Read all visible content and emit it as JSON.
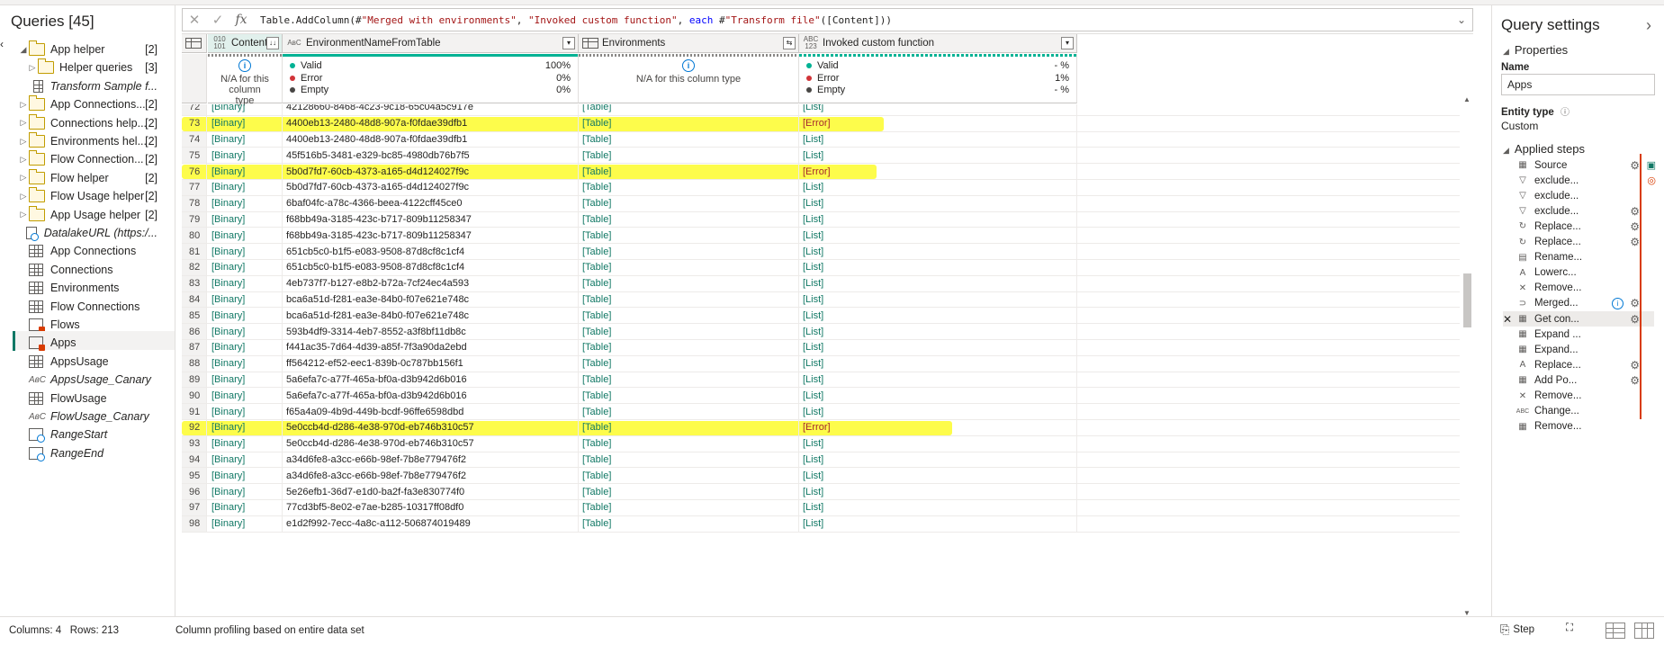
{
  "queries": {
    "title": "Queries [45]",
    "items": [
      {
        "label": "App helper",
        "count": "[2]",
        "type": "folder",
        "expand": "◢",
        "indent": 0
      },
      {
        "label": "Helper queries",
        "count": "[3]",
        "type": "folder",
        "expand": "▷",
        "indent": 1
      },
      {
        "label": "Transform Sample f...",
        "count": "",
        "type": "table",
        "expand": "",
        "indent": 1,
        "italic": true
      },
      {
        "label": "App Connections...",
        "count": "[2]",
        "type": "folder",
        "expand": "▷",
        "indent": 0
      },
      {
        "label": "Connections help...",
        "count": "[2]",
        "type": "folder",
        "expand": "▷",
        "indent": 0
      },
      {
        "label": "Environments hel...",
        "count": "[2]",
        "type": "folder",
        "expand": "▷",
        "indent": 0
      },
      {
        "label": "Flow Connection...",
        "count": "[2]",
        "type": "folder",
        "expand": "▷",
        "indent": 0
      },
      {
        "label": "Flow helper",
        "count": "[2]",
        "type": "folder",
        "expand": "▷",
        "indent": 0
      },
      {
        "label": "Flow Usage helper",
        "count": "[2]",
        "type": "folder",
        "expand": "▷",
        "indent": 0
      },
      {
        "label": "App Usage helper",
        "count": "[2]",
        "type": "folder",
        "expand": "▷",
        "indent": 0
      },
      {
        "label": "DatalakeURL (https:/...",
        "count": "",
        "type": "param",
        "expand": "",
        "indent": 0,
        "italic": true
      },
      {
        "label": "App Connections",
        "count": "",
        "type": "table",
        "expand": "",
        "indent": 0
      },
      {
        "label": "Connections",
        "count": "",
        "type": "table",
        "expand": "",
        "indent": 0
      },
      {
        "label": "Environments",
        "count": "",
        "type": "table",
        "expand": "",
        "indent": 0
      },
      {
        "label": "Flow Connections",
        "count": "",
        "type": "table",
        "expand": "",
        "indent": 0
      },
      {
        "label": "Flows",
        "count": "",
        "type": "tablewarn",
        "expand": "",
        "indent": 0
      },
      {
        "label": "Apps",
        "count": "",
        "type": "tablewarn",
        "expand": "",
        "indent": 0,
        "selected": true
      },
      {
        "label": "AppsUsage",
        "count": "",
        "type": "table",
        "expand": "",
        "indent": 0
      },
      {
        "label": "AppsUsage_Canary",
        "count": "",
        "type": "abc",
        "expand": "",
        "indent": 0,
        "italic": true
      },
      {
        "label": "FlowUsage",
        "count": "",
        "type": "table",
        "expand": "",
        "indent": 0
      },
      {
        "label": "FlowUsage_Canary",
        "count": "",
        "type": "abc",
        "expand": "",
        "indent": 0,
        "italic": true
      },
      {
        "label": "RangeStart",
        "count": "",
        "type": "param",
        "expand": "",
        "indent": 0,
        "italic": true
      },
      {
        "label": "RangeEnd",
        "count": "",
        "type": "param",
        "expand": "",
        "indent": 0,
        "italic": true
      }
    ]
  },
  "formula": {
    "cancel": "✕",
    "commit": "✓",
    "fx": "fx",
    "parts": [
      {
        "t": "Table.AddColumn(#",
        "c": ""
      },
      {
        "t": "\"Merged with environments\"",
        "c": "s"
      },
      {
        "t": ", ",
        "c": ""
      },
      {
        "t": "\"Invoked custom function\"",
        "c": "s"
      },
      {
        "t": ", ",
        "c": ""
      },
      {
        "t": "each",
        "c": "k"
      },
      {
        "t": " #",
        "c": ""
      },
      {
        "t": "\"Transform file\"",
        "c": "s"
      },
      {
        "t": "([Content]))",
        "c": ""
      }
    ]
  },
  "columns": [
    {
      "name": "Content",
      "type": "010\n101",
      "sort": "↓↓",
      "quality": "na",
      "na_text": "N/A for this column type"
    },
    {
      "name": "EnvironmentNameFromTable",
      "type": "AʙC",
      "dd": "▾",
      "quality": "stats",
      "stats": [
        {
          "label": "Valid",
          "pct": "100%",
          "color": "#00b294"
        },
        {
          "label": "Error",
          "pct": "0%",
          "color": "#d13438"
        },
        {
          "label": "Empty",
          "pct": "0%",
          "color": "#484644"
        }
      ]
    },
    {
      "name": "Environments",
      "type": "table",
      "dd": "⇆",
      "quality": "na",
      "na_text": "N/A for this column type"
    },
    {
      "name": "Invoked custom function",
      "type": "ABC\n123",
      "dd": "▾",
      "quality": "stats",
      "stats": [
        {
          "label": "Valid",
          "pct": "- %",
          "color": "#00b294"
        },
        {
          "label": "Error",
          "pct": "1%",
          "color": "#d13438"
        },
        {
          "label": "Empty",
          "pct": "- %",
          "color": "#484644"
        }
      ]
    }
  ],
  "rows": [
    {
      "n": "72",
      "content": "[Binary]",
      "env": "42128660-8468-4c23-9c18-65c04a5c917e",
      "envs": "[Table]",
      "fn": "[List]"
    },
    {
      "n": "73",
      "content": "[Binary]",
      "env": "4400eb13-2480-48d8-907a-f0fdae39dfb1",
      "envs": "[Table]",
      "fn": "[Error]",
      "highlight": true
    },
    {
      "n": "74",
      "content": "[Binary]",
      "env": "4400eb13-2480-48d8-907a-f0fdae39dfb1",
      "envs": "[Table]",
      "fn": "[List]"
    },
    {
      "n": "75",
      "content": "[Binary]",
      "env": "45f516b5-3481-e329-bc85-4980db76b7f5",
      "envs": "[Table]",
      "fn": "[List]"
    },
    {
      "n": "76",
      "content": "[Binary]",
      "env": "5b0d7fd7-60cb-4373-a165-d4d124027f9c",
      "envs": "[Table]",
      "fn": "[Error]",
      "highlight": true
    },
    {
      "n": "77",
      "content": "[Binary]",
      "env": "5b0d7fd7-60cb-4373-a165-d4d124027f9c",
      "envs": "[Table]",
      "fn": "[List]"
    },
    {
      "n": "78",
      "content": "[Binary]",
      "env": "6baf04fc-a78c-4366-beea-4122cff45ce0",
      "envs": "[Table]",
      "fn": "[List]"
    },
    {
      "n": "79",
      "content": "[Binary]",
      "env": "f68bb49a-3185-423c-b717-809b11258347",
      "envs": "[Table]",
      "fn": "[List]"
    },
    {
      "n": "80",
      "content": "[Binary]",
      "env": "f68bb49a-3185-423c-b717-809b11258347",
      "envs": "[Table]",
      "fn": "[List]"
    },
    {
      "n": "81",
      "content": "[Binary]",
      "env": "651cb5c0-b1f5-e083-9508-87d8cf8c1cf4",
      "envs": "[Table]",
      "fn": "[List]"
    },
    {
      "n": "82",
      "content": "[Binary]",
      "env": "651cb5c0-b1f5-e083-9508-87d8cf8c1cf4",
      "envs": "[Table]",
      "fn": "[List]"
    },
    {
      "n": "83",
      "content": "[Binary]",
      "env": "4eb737f7-b127-e8b2-b72a-7cf24ec4a593",
      "envs": "[Table]",
      "fn": "[List]"
    },
    {
      "n": "84",
      "content": "[Binary]",
      "env": "bca6a51d-f281-ea3e-84b0-f07e621e748c",
      "envs": "[Table]",
      "fn": "[List]"
    },
    {
      "n": "85",
      "content": "[Binary]",
      "env": "bca6a51d-f281-ea3e-84b0-f07e621e748c",
      "envs": "[Table]",
      "fn": "[List]"
    },
    {
      "n": "86",
      "content": "[Binary]",
      "env": "593b4df9-3314-4eb7-8552-a3f8bf11db8c",
      "envs": "[Table]",
      "fn": "[List]"
    },
    {
      "n": "87",
      "content": "[Binary]",
      "env": "f441ac35-7d64-4d39-a85f-7f3a90da2ebd",
      "envs": "[Table]",
      "fn": "[List]"
    },
    {
      "n": "88",
      "content": "[Binary]",
      "env": "ff564212-ef52-eec1-839b-0c787bb156f1",
      "envs": "[Table]",
      "fn": "[List]"
    },
    {
      "n": "89",
      "content": "[Binary]",
      "env": "5a6efa7c-a77f-465a-bf0a-d3b942d6b016",
      "envs": "[Table]",
      "fn": "[List]"
    },
    {
      "n": "90",
      "content": "[Binary]",
      "env": "5a6efa7c-a77f-465a-bf0a-d3b942d6b016",
      "envs": "[Table]",
      "fn": "[List]"
    },
    {
      "n": "91",
      "content": "[Binary]",
      "env": "f65a4a09-4b9d-449b-bcdf-96ffe6598dbd",
      "envs": "[Table]",
      "fn": "[List]"
    },
    {
      "n": "92",
      "content": "[Binary]",
      "env": "5e0ccb4d-d286-4e38-970d-eb746b310c57",
      "envs": "[Table]",
      "fn": "[Error]",
      "highlight": true
    },
    {
      "n": "93",
      "content": "[Binary]",
      "env": "5e0ccb4d-d286-4e38-970d-eb746b310c57",
      "envs": "[Table]",
      "fn": "[List]"
    },
    {
      "n": "94",
      "content": "[Binary]",
      "env": "a34d6fe8-a3cc-e66b-98ef-7b8e779476f2",
      "envs": "[Table]",
      "fn": "[List]"
    },
    {
      "n": "95",
      "content": "[Binary]",
      "env": "a34d6fe8-a3cc-e66b-98ef-7b8e779476f2",
      "envs": "[Table]",
      "fn": "[List]"
    },
    {
      "n": "96",
      "content": "[Binary]",
      "env": "5e26efb1-36d7-e1d0-ba2f-fa3e830774f0",
      "envs": "[Table]",
      "fn": "[List]"
    },
    {
      "n": "97",
      "content": "[Binary]",
      "env": "77cd3bf5-8e02-e7ae-b285-10317ff08df0",
      "envs": "[Table]",
      "fn": "[List]"
    },
    {
      "n": "98",
      "content": "[Binary]",
      "env": "e1d2f992-7ecc-4a8c-a112-506874019489",
      "envs": "[Table]",
      "fn": "[List]"
    }
  ],
  "settings": {
    "title": "Query settings",
    "properties_label": "Properties",
    "name_label": "Name",
    "name_value": "Apps",
    "entity_type_label": "Entity type",
    "entity_type_value": "Custom",
    "applied_steps_label": "Applied steps",
    "steps": [
      {
        "label": "Source",
        "icon": "▦",
        "gear": true,
        "extra": "nav"
      },
      {
        "label": "exclude...",
        "icon": "▽",
        "gear": false,
        "extra": "warn"
      },
      {
        "label": "exclude...",
        "icon": "▽",
        "gear": false
      },
      {
        "label": "exclude...",
        "icon": "▽",
        "gear": true
      },
      {
        "label": "Replace...",
        "icon": "↻",
        "gear": true
      },
      {
        "label": "Replace...",
        "icon": "↻",
        "gear": true
      },
      {
        "label": "Rename...",
        "icon": "▤",
        "gear": false
      },
      {
        "label": "Lowerc...",
        "icon": "A",
        "gear": false
      },
      {
        "label": "Remove...",
        "icon": "✕",
        "gear": false
      },
      {
        "label": "Merged...",
        "icon": "⊃",
        "gear": true,
        "info": true
      },
      {
        "label": "Get con...",
        "icon": "▦",
        "gear": true,
        "active": true
      },
      {
        "label": "Expand ...",
        "icon": "▦",
        "gear": false
      },
      {
        "label": "Expand...",
        "icon": "▦",
        "gear": false
      },
      {
        "label": "Replace...",
        "icon": "A",
        "gear": true
      },
      {
        "label": "Add Po...",
        "icon": "▦",
        "gear": true
      },
      {
        "label": "Remove...",
        "icon": "✕",
        "gear": false
      },
      {
        "label": "Change...",
        "icon": "ABC",
        "gear": false
      },
      {
        "label": "Remove...",
        "icon": "▦",
        "gear": false
      }
    ]
  },
  "status": {
    "columns_rows": "Columns: 4   Rows: 213",
    "profiling": "Column profiling based on entire data set",
    "step_label": "Step"
  },
  "colors": {
    "accent": "#117865",
    "highlight": "#fdfb2c",
    "error": "#a4262c",
    "valid": "#00b294"
  }
}
